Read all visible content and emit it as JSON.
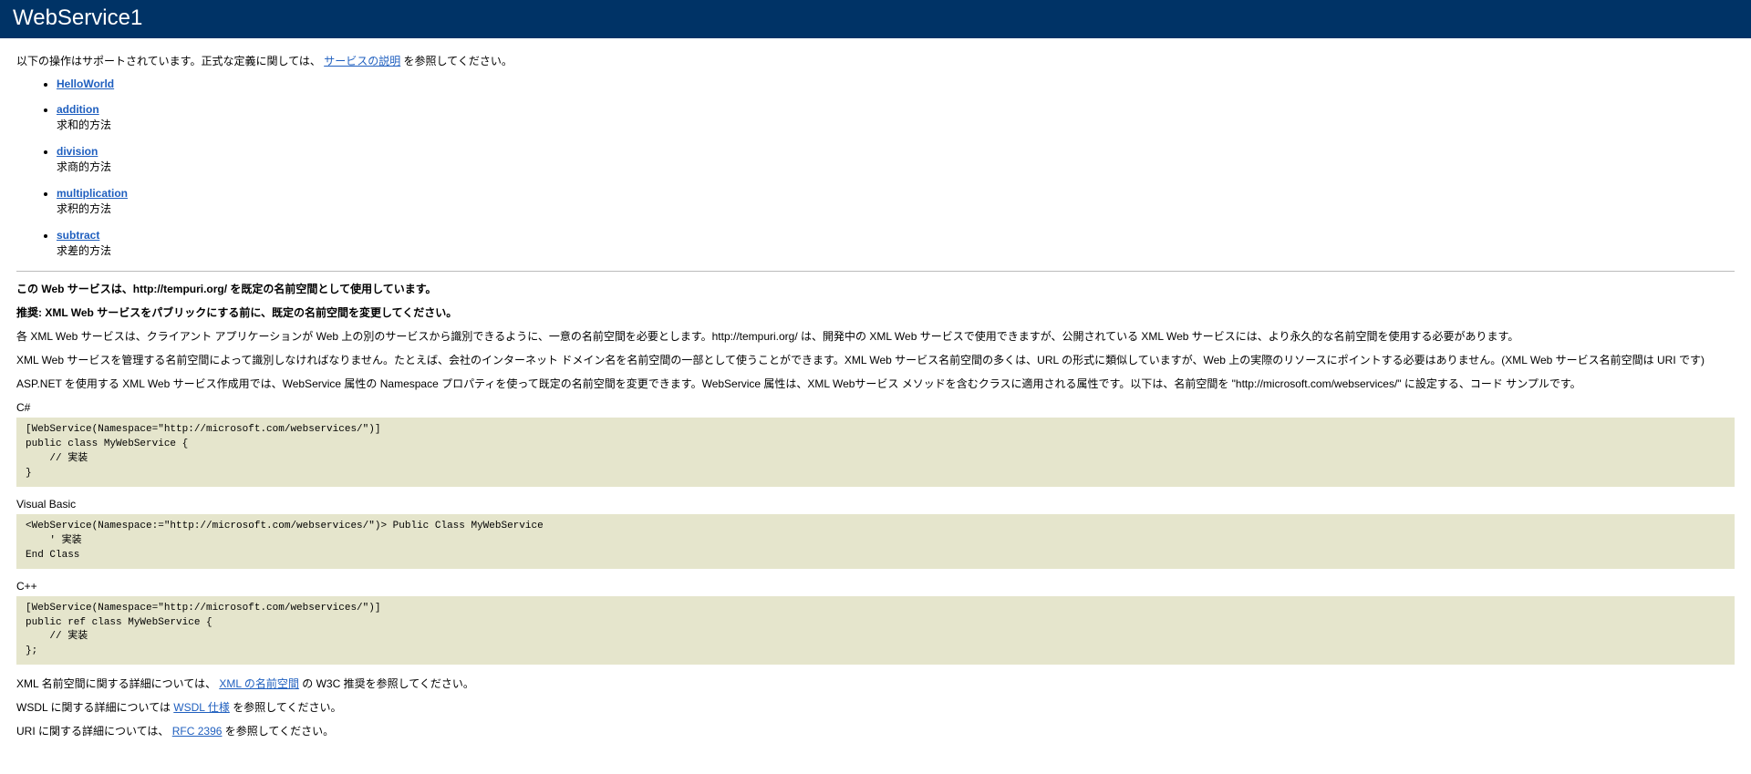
{
  "header": {
    "title": "WebService1"
  },
  "intro": {
    "prefix": "以下の操作はサポートされています。正式な定義に関しては、",
    "link": "サービスの説明",
    "suffix": " を参照してください。"
  },
  "operations": [
    {
      "name": "HelloWorld",
      "desc": ""
    },
    {
      "name": "addition",
      "desc": "求和的方法"
    },
    {
      "name": "division",
      "desc": "求商的方法"
    },
    {
      "name": "multiplication",
      "desc": "求积的方法"
    },
    {
      "name": "subtract",
      "desc": "求差的方法"
    }
  ],
  "namespace_section": {
    "p1": "この Web サービスは、http://tempuri.org/ を既定の名前空間として使用しています。",
    "p2": "推奨: XML Web サービスをパブリックにする前に、既定の名前空間を変更してください。",
    "p3": "各 XML Web サービスは、クライアント アプリケーションが Web 上の別のサービスから識別できるように、一意の名前空間を必要とします。http://tempuri.org/ は、開発中の XML Web サービスで使用できますが、公開されている XML Web サービスには、より永久的な名前空間を使用する必要があります。",
    "p4": "XML Web サービスを管理する名前空間によって識別しなければなりません。たとえば、会社のインターネット ドメイン名を名前空間の一部として使うことができます。XML Web サービス名前空間の多くは、URL の形式に類似していますが、Web 上の実際のリソースにポイントする必要はありません。(XML Web サービス名前空間は URI です)",
    "p5": "ASP.NET を使用する XML Web サービス作成用では、WebService 属性の Namespace プロパティを使って既定の名前空間を変更できます。WebService 属性は、XML Webサービス メソッドを含むクラスに適用される属性です。以下は、名前空間を \"http://microsoft.com/webservices/\" に設定する、コード サンプルです。"
  },
  "code": {
    "csharp_label": "C#",
    "csharp": "[WebService(Namespace=\"http://microsoft.com/webservices/\")]\npublic class MyWebService {\n    // 実装\n}",
    "vb_label": "Visual Basic",
    "vb": "<WebService(Namespace:=\"http://microsoft.com/webservices/\")> Public Class MyWebService\n    ' 実装\nEnd Class",
    "cpp_label": "C++",
    "cpp": "[WebService(Namespace=\"http://microsoft.com/webservices/\")]\npublic ref class MyWebService {\n    // 実装\n};"
  },
  "footer": {
    "xml_ns_prefix": "XML 名前空間に関する詳細については、",
    "xml_ns_link": "XML の名前空間",
    "xml_ns_suffix": " の W3C 推奨を参照してください。",
    "wsdl_prefix": "WSDL に関する詳細については ",
    "wsdl_link": "WSDL 仕様",
    "wsdl_suffix": " を参照してください。",
    "uri_prefix": "URI に関する詳細については、",
    "uri_link": "RFC 2396",
    "uri_suffix": " を参照してください。"
  }
}
